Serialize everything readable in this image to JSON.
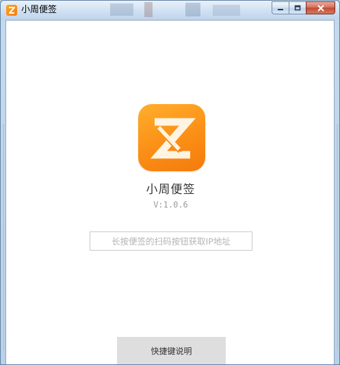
{
  "window": {
    "title": "小周便签",
    "controls": {
      "minimize_icon": "minimize-icon",
      "maximize_icon": "maximize-icon",
      "close_icon": "close-icon"
    }
  },
  "app": {
    "name": "小周便签",
    "version": "V:1.0.6",
    "logo_icon": "note-z-logo",
    "brand_color": "#F98A16"
  },
  "ip_field": {
    "value": "",
    "placeholder": "长按便签的扫码按钮获取IP地址"
  },
  "shortcut_button": {
    "label": "快捷键说明"
  }
}
